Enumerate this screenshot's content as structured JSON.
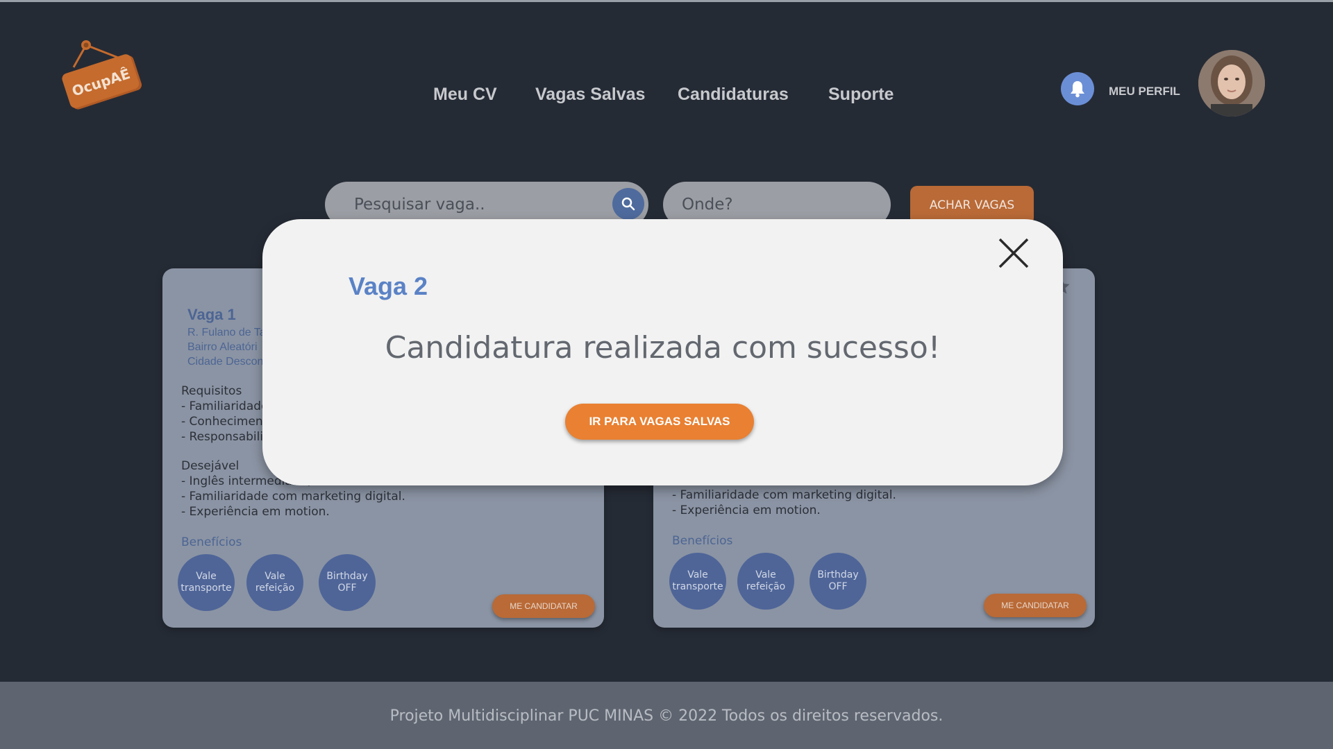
{
  "header": {
    "logo_text": "OcupAÊ",
    "nav": [
      "Meu CV",
      "Vagas Salvas",
      "Candidaturas",
      "Suporte"
    ],
    "profile_label": "MEU PERFIL"
  },
  "search": {
    "job_placeholder": "Pesquisar vaga..",
    "location_placeholder": "Onde?",
    "find_button": "ACHAR VAGAS"
  },
  "cards": [
    {
      "title": "Vaga 1",
      "address": [
        "R. Fulano de Ta",
        "Bairro Aleatóri",
        "Cidade Descon"
      ],
      "requirements_title": "Requisitos",
      "requirements": [
        "-  Familiaridade",
        "- Conhecimento",
        "- Responsabilid"
      ],
      "desired_title": "Desejável",
      "desired": [
        "- Inglês intermediário,",
        "- Familiaridade com marketing digital.",
        "- Experiência em motion."
      ],
      "benefits_title": "Benefícios",
      "benefits": [
        "Vale transporte",
        "Vale refeição",
        "Birthday OFF"
      ],
      "apply_button": "ME CANDIDATAR"
    },
    {
      "desired": [
        "- Familiaridade com marketing digital.",
        "- Experiência em motion."
      ],
      "benefits_title": "Benefícios",
      "benefits": [
        "Vale transporte",
        "Vale refeição",
        "Birthday OFF"
      ],
      "apply_button": "ME CANDIDATAR"
    }
  ],
  "modal": {
    "title": "Vaga 2",
    "message": "Candidatura realizada com sucesso!",
    "button": "IR PARA VAGAS SALVAS"
  },
  "footer": {
    "text": "Projeto Multidisciplinar  PUC MINAS © 2022 Todos os direitos reservados."
  },
  "colors": {
    "background": "#252b35",
    "accent_orange": "#e98032",
    "accent_blue": "#5a82c6",
    "card": "#8b94a4",
    "footer": "#5f6570"
  }
}
